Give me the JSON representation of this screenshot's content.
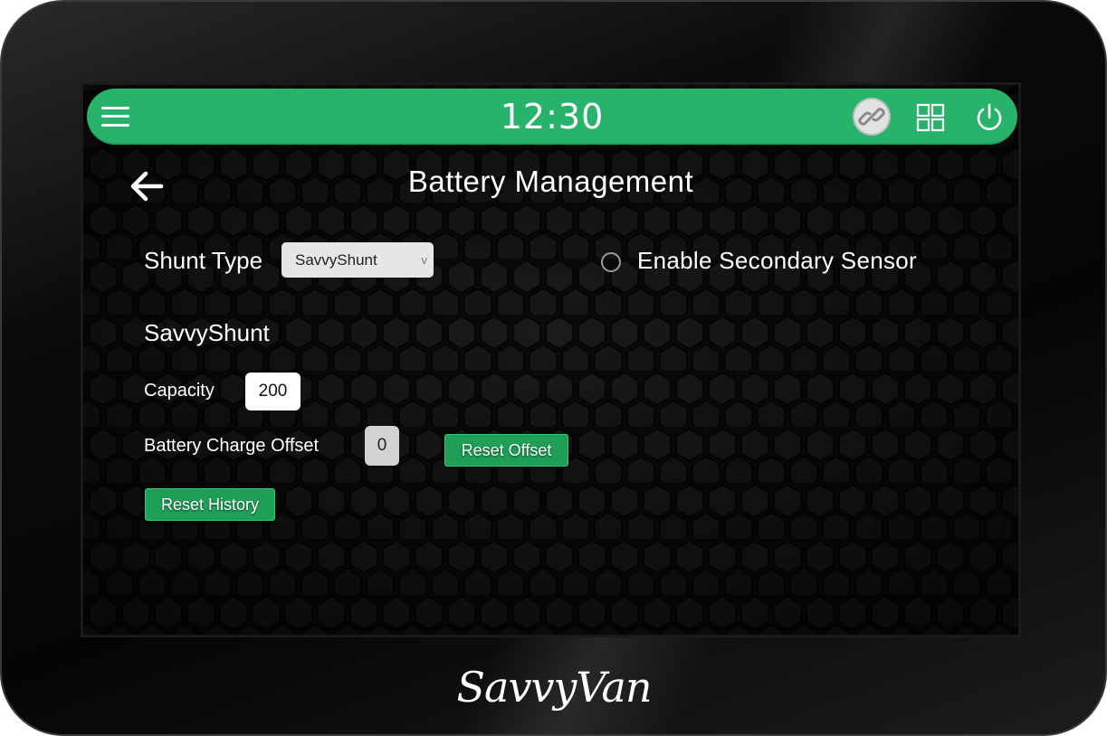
{
  "device": {
    "brand": "SavvyVan"
  },
  "header": {
    "time": "12:30",
    "icons": [
      "menu-icon",
      "link-icon",
      "grid-icon",
      "power-icon"
    ]
  },
  "page": {
    "title": "Battery Management",
    "back_icon": "back-arrow-icon"
  },
  "shunt": {
    "label": "Shunt Type",
    "selected": "SavvyShunt",
    "chevron": "v"
  },
  "secondary_sensor": {
    "label": "Enable Secondary Sensor",
    "checked": false
  },
  "section": {
    "title": "SavvyShunt",
    "capacity_label": "Capacity",
    "capacity_value": "200",
    "offset_label": "Battery Charge Offset",
    "offset_value": "0",
    "reset_offset": "Reset Offset",
    "reset_history": "Reset History"
  },
  "colors": {
    "accent": "#27b46a",
    "button": "#1f9e57",
    "screen_bg": "#070707"
  }
}
